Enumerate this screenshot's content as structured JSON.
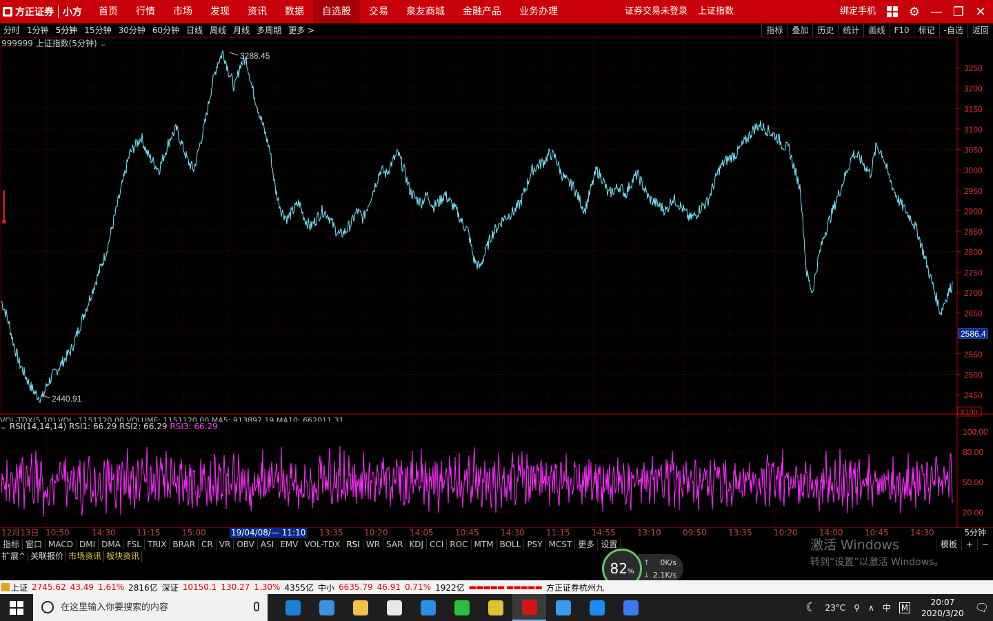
{
  "app": {
    "logo_cn": "方正证券",
    "logo_sub": "小方"
  },
  "nav": [
    "首页",
    "行情",
    "市场",
    "发现",
    "资讯",
    "数据",
    "自选股",
    "交易",
    "泉友商城",
    "金融产品",
    "业务办理"
  ],
  "nav_active": "自选股",
  "top": {
    "trade_status": "证券交易未登录",
    "index_name": "上证指数",
    "bind_phone": "绑定手机"
  },
  "periods": [
    "分时",
    "1分钟",
    "5分钟",
    "15分钟",
    "30分钟",
    "60分钟",
    "日线",
    "周线",
    "月线",
    "多周期",
    "更多 >"
  ],
  "period_selected": "5分钟",
  "right_tools": [
    "指标",
    "叠加",
    "历史",
    "统计",
    "画线",
    "F10",
    "标记",
    "-自选",
    "返回"
  ],
  "chart_header": "999999 上证指数(5分钟)",
  "rsi_header": {
    "name": "RSI(14,14,14)",
    "rsi1": "RSI1: 66.29",
    "rsi2": "RSI2: 66.29",
    "rsi3": "RSI3: 66.29"
  },
  "vol_header_partial": "VOL-TDX(5,10)  VOL: 1151120.00  VOLUME: 1151120.00  MA5: 913897.19  MA10: 662011.31",
  "chart_data": [
    {
      "type": "line",
      "title": "999999 上证指数(5分钟)",
      "price_ticks": [
        3250,
        3200,
        3150,
        3100,
        3050,
        3000,
        2950,
        2900,
        2850,
        2800,
        2750,
        2700,
        2650,
        2600,
        2550,
        2500,
        2450
      ],
      "price_tick_labels": [
        "3250",
        "3200",
        "3150",
        "3100",
        "3050",
        "3000",
        "2950",
        "2900",
        "2850",
        "2800",
        "2750",
        "2700",
        "2650",
        "2586.4",
        "2550",
        "2500",
        "2450"
      ],
      "ylim": [
        2420,
        3300
      ],
      "current_price_label": "2586.4",
      "high_label": "3288.45",
      "low_label": "2440.91",
      "path_points": [
        2680,
        2640,
        2580,
        2530,
        2500,
        2470,
        2450,
        2441,
        2480,
        2500,
        2520,
        2540,
        2560,
        2600,
        2640,
        2680,
        2720,
        2760,
        2800,
        2860,
        2920,
        2980,
        3040,
        3060,
        3080,
        3040,
        3020,
        3000,
        3040,
        3080,
        3100,
        3060,
        3020,
        3000,
        3060,
        3120,
        3200,
        3260,
        3288,
        3240,
        3200,
        3260,
        3270,
        3200,
        3150,
        3100,
        3050,
        2950,
        2900,
        2880,
        2900,
        2920,
        2880,
        2860,
        2880,
        2900,
        2890,
        2860,
        2840,
        2850,
        2870,
        2900,
        2880,
        2920,
        2960,
        3000,
        2990,
        3020,
        3040,
        3000,
        2950,
        2930,
        2920,
        2940,
        2910,
        2920,
        2940,
        2920,
        2900,
        2870,
        2850,
        2780,
        2760,
        2800,
        2840,
        2860,
        2880,
        2890,
        2900,
        2920,
        2960,
        3000,
        3010,
        3020,
        3040,
        3030,
        2990,
        2970,
        2960,
        2930,
        2900,
        2950,
        3000,
        2980,
        2940,
        2950,
        2960,
        2940,
        2970,
        2990,
        2960,
        2930,
        2920,
        2910,
        2900,
        2930,
        2920,
        2900,
        2880,
        2890,
        2910,
        2920,
        2960,
        3000,
        3020,
        3030,
        3040,
        3060,
        3080,
        3100,
        3110,
        3100,
        3090,
        3080,
        3060,
        3050,
        3000,
        2950,
        2750,
        2700,
        2780,
        2840,
        2880,
        2920,
        2960,
        3000,
        3040,
        3030,
        3010,
        2990,
        3060,
        3040,
        2990,
        2950,
        2920,
        2900,
        2880,
        2850,
        2800,
        2750,
        2700,
        2650,
        2690,
        2720
      ]
    },
    {
      "type": "line",
      "title": "RSI(14,14,14)",
      "y_ticks": [
        100,
        80,
        50,
        20
      ],
      "y_tick_labels": [
        "100.00",
        "80.00",
        "50.00",
        "20.00"
      ],
      "ylim": [
        0,
        110
      ],
      "series": [
        {
          "name": "RSI1",
          "value": 66.29
        },
        {
          "name": "RSI2",
          "value": 66.29
        },
        {
          "name": "RSI3",
          "value": 66.29
        }
      ]
    }
  ],
  "time_axis": [
    "12月13日",
    "10:50",
    "14:30",
    "11:15",
    "15:00",
    "19/04/08/— 11:10",
    "13:35",
    "10:20",
    "14:05",
    "10:45",
    "14:30",
    "11:15",
    "14:55",
    "13:10",
    "09:50",
    "13:35",
    "10:20",
    "14:00",
    "10:45",
    "14:30"
  ],
  "time_axis_highlight": "19/04/08/— 11:10",
  "period_label": "5分钟",
  "indicator_tabs": [
    "指标",
    "窗口",
    "MACD",
    "DMI",
    "DMA",
    "FSL",
    "TRIX",
    "BRAR",
    "CR",
    "VR",
    "OBV",
    "ASI",
    "EMV",
    "VOL-TDX",
    "RSI",
    "WR",
    "SAR",
    "KDJ",
    "CCI",
    "ROC",
    "MTM",
    "BOLL",
    "PSY",
    "MCST",
    "更多",
    "设置"
  ],
  "indicator_selected": "RSI",
  "x100_label": "X100",
  "template_buttons": [
    "模板",
    "+",
    "−"
  ],
  "extra_tabs": [
    "扩展^",
    "关联报价",
    "市场资讯",
    "板块资讯"
  ],
  "watermark": {
    "line1": "激活 Windows",
    "line2": "转到“设置”以激活 Windows。"
  },
  "statusbar": {
    "sh_label": "上证",
    "sh_price": "2745.62",
    "sh_change": "43.49",
    "sh_pct": "1.61%",
    "sh_amount": "2816亿",
    "sz_label": "深证",
    "sz_price": "10150.1",
    "sz_change": "130.27",
    "sz_pct": "1.30%",
    "sz_amount": "4355亿",
    "zx_label": "中小",
    "zx_price": "6635.79",
    "zx_change": "46.91",
    "zx_pct": "0.71%",
    "zx_amount": "1922亿",
    "broker": "方正证券杭州九"
  },
  "netmon": {
    "percent": "82",
    "unit": "%",
    "up": "0K/s",
    "down": "2.1K/s"
  },
  "taskbar": {
    "search_placeholder": "在这里输入你要搜索的内容",
    "temp": "23°C",
    "ime_lang": "中",
    "ime_mode": "M",
    "time": "20:07",
    "date": "2020/3/20",
    "apps": [
      {
        "name": "edge-icon",
        "color": "#1e7fd6"
      },
      {
        "name": "store-icon",
        "color": "#3b8fe0"
      },
      {
        "name": "explorer-icon",
        "color": "#f0c24a"
      },
      {
        "name": "mail-icon",
        "color": "#e8e8e8"
      },
      {
        "name": "ie-icon",
        "color": "#2a8fe8"
      },
      {
        "name": "wechat-icon",
        "color": "#2cbf3c"
      },
      {
        "name": "chrome-icon",
        "color": "#e2c036"
      },
      {
        "name": "founder-icon",
        "color": "#d01818"
      },
      {
        "name": "feishu-icon",
        "color": "#3a9af0"
      },
      {
        "name": "phone-icon",
        "color": "#1b8cf2"
      },
      {
        "name": "wps-icon",
        "color": "#3a7cf0"
      }
    ]
  }
}
